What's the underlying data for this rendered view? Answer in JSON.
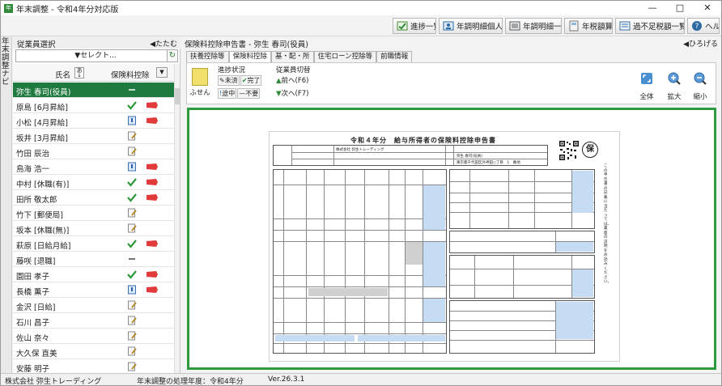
{
  "window": {
    "title": "年末調整 - 令和4年分対応版",
    "app_icon_text": "年",
    "minimize": "—",
    "maximize": "□",
    "close": "✕"
  },
  "toolbar": {
    "buttons": [
      {
        "label": "進捗一覧",
        "icon": "progress-icon"
      },
      {
        "label": "年調明細個人別",
        "icon": "person-detail-icon"
      },
      {
        "label": "年調明細一覧",
        "icon": "detail-list-icon"
      },
      {
        "label": "年税額算出",
        "icon": "tax-calc-icon"
      },
      {
        "label": "過不足税額一覧",
        "icon": "balance-list-icon"
      },
      {
        "label": "ヘルプ",
        "icon": "help-icon"
      }
    ]
  },
  "vnav": {
    "label": "年末調整ナビ"
  },
  "employee_panel": {
    "title": "従業員選択",
    "collapse": "◀たたむ",
    "select_placeholder": "▼セレクト...",
    "refresh_icon": "↻",
    "col_name": "氏名",
    "col_sort": "あ↓",
    "col_status": "保険料控除",
    "employees": [
      {
        "name": "弥生 春司(役員)",
        "selected": true,
        "status": "—",
        "tag": ""
      },
      {
        "name": "原島 [6月昇給]",
        "status": "check",
        "tag": "red"
      },
      {
        "name": "小松 [4月昇給]",
        "status": "blue",
        "tag": "red"
      },
      {
        "name": "坂井 [3月昇給]",
        "status": "edit",
        "tag": ""
      },
      {
        "name": "竹田 辰治",
        "status": "edit",
        "tag": ""
      },
      {
        "name": "鳥海 浩一",
        "status": "blue",
        "tag": "red"
      },
      {
        "name": "中村 [休職(有)]",
        "status": "check",
        "tag": "red"
      },
      {
        "name": "田所 敬太郎",
        "status": "check",
        "tag": "red"
      },
      {
        "name": "竹下 [郵便局]",
        "status": "edit",
        "tag": ""
      },
      {
        "name": "坂本 [休職(無)]",
        "status": "edit",
        "tag": ""
      },
      {
        "name": "萩原 [日給月給]",
        "status": "check",
        "tag": "red"
      },
      {
        "name": "藤咲 [退職]",
        "status": "—",
        "tag": ""
      },
      {
        "name": "園田 孝子",
        "status": "check",
        "tag": "red"
      },
      {
        "name": "長橋 薫子",
        "status": "blue",
        "tag": "red"
      },
      {
        "name": "金沢 [日給]",
        "status": "edit",
        "tag": ""
      },
      {
        "name": "石川 昌子",
        "status": "edit",
        "tag": ""
      },
      {
        "name": "佐山 奈々",
        "status": "edit",
        "tag": ""
      },
      {
        "name": "大久保 直美",
        "status": "edit",
        "tag": ""
      },
      {
        "name": "安藤 明子",
        "status": "edit",
        "tag": ""
      }
    ]
  },
  "right_panel": {
    "title": "保険料控除申告書 - 弥生 春司(役員)",
    "expand": "◀ひろげる",
    "tabs": [
      "扶養控除等",
      "保険料控除",
      "基・配・所",
      "住宅ローン控除等",
      "前職情報"
    ],
    "active_tab": 1,
    "ribbon": {
      "fusen": "ふせん",
      "progress_label": "進捗状況",
      "btn_mikan": "未済",
      "btn_kanryo": "完了",
      "btn_tochu": "途中",
      "btn_fuyo": "不要",
      "emp_switch_label": "従業員切替",
      "btn_prev": "前へ(F6)",
      "btn_next": "次へ(F7)",
      "view_all": "全体",
      "zoom_in": "拡大",
      "zoom_out": "縮小"
    },
    "document": {
      "title": "令和４年分　給与所得者の保険料控除申告書",
      "hoz": "保",
      "company": "株式会社 弥生トレーディング",
      "employee": "弥生 春司(役員)",
      "address": "東京都千代田区外神田○丁目　1　番地",
      "side_text": "この申告書の記載に当たっては、裏面の説明をお読みください。"
    }
  },
  "statusbar": {
    "company": "株式会社 弥生トレーディング",
    "year": "年末調整の処理年度：令和4年分",
    "version": "Ver.26.3.1"
  }
}
